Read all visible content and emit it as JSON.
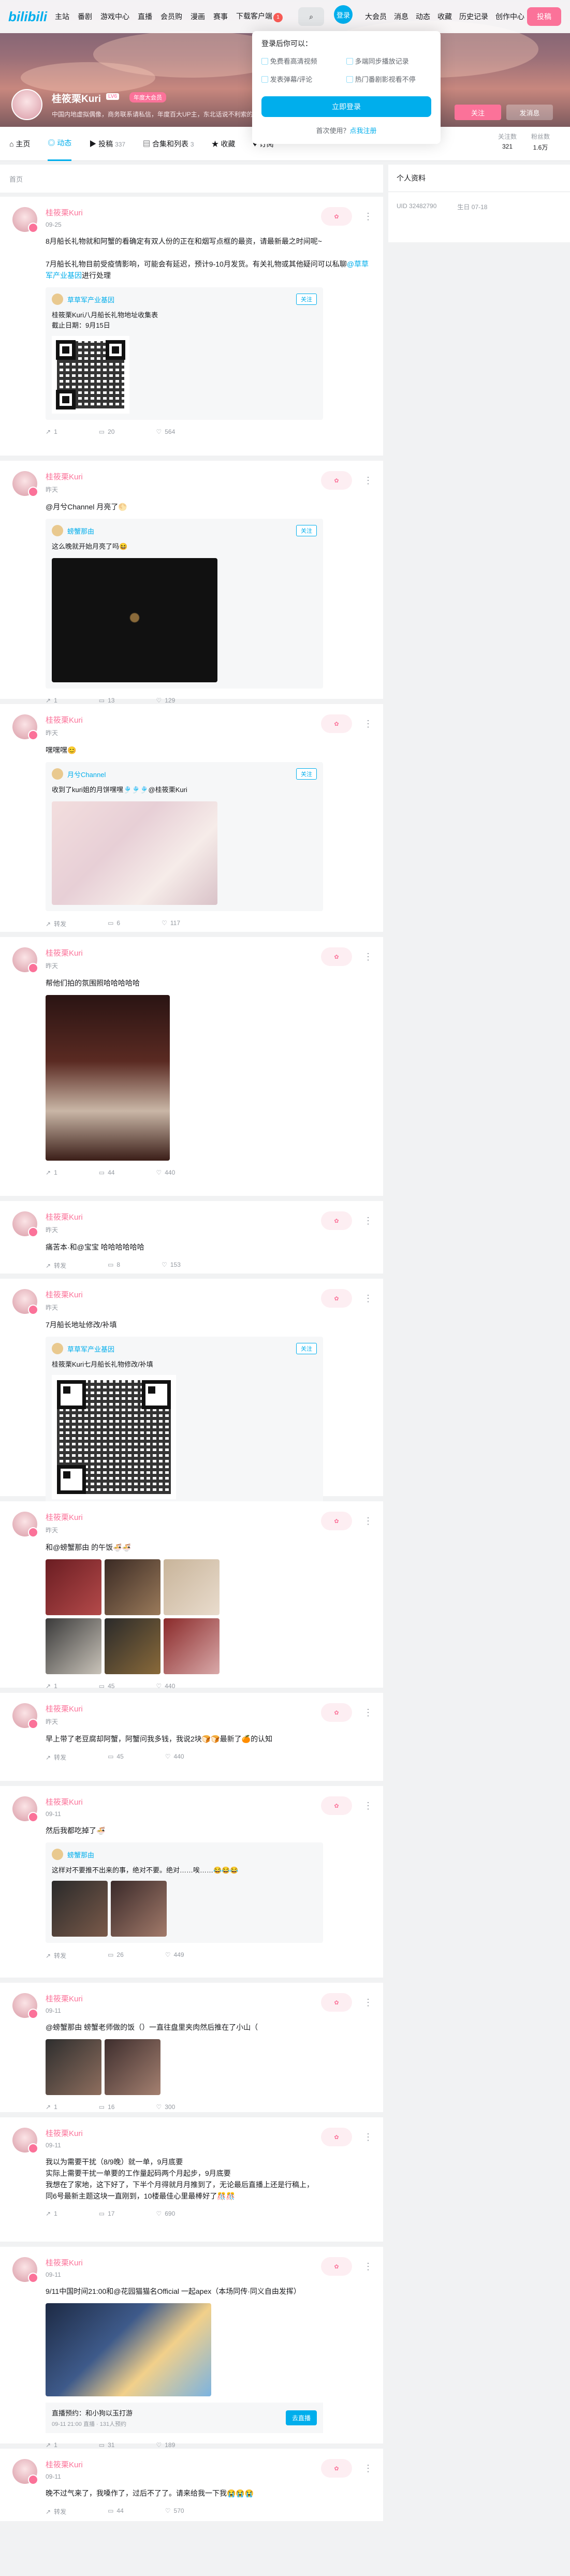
{
  "nav": {
    "logo": "bilibili",
    "items": [
      "主站",
      "番剧",
      "游戏中心",
      "直播",
      "会员购",
      "漫画",
      "赛事",
      "下载客户端"
    ],
    "download_badge": "1",
    "login": "登录",
    "right": [
      "大会员",
      "消息",
      "动态",
      "收藏",
      "历史记录",
      "创作中心"
    ],
    "contribute": "投稿"
  },
  "popup": {
    "title": "登录后你可以：",
    "features": [
      "免费看高清视频",
      "多端同步播放记录",
      "发表弹幕/评论",
      "热门番剧影视看不停"
    ],
    "login_btn": "立即登录",
    "register_prefix": "首次使用？",
    "register_link": "点我注册"
  },
  "profile": {
    "name": "桂筱栗Kuri",
    "level": "LV6",
    "vip": "年度大会员",
    "sign": "中国内地虚拟偶像，商务联系请私信，年度百大UP主，东北话说不利索的东北人",
    "follow": "关注",
    "message": "发消息"
  },
  "tabs": [
    {
      "label": "主页"
    },
    {
      "label": "动态"
    },
    {
      "label": "投稿",
      "count": "337"
    },
    {
      "label": "合集和列表",
      "count": "3"
    },
    {
      "label": "收藏"
    },
    {
      "label": "订阅"
    }
  ],
  "stats": [
    {
      "label": "关注数",
      "value": "321"
    },
    {
      "label": "粉丝数",
      "value": "1.6万"
    }
  ],
  "crumb": "首页",
  "side": {
    "title": "个人资料",
    "uid_label": "UID",
    "uid": "32482790",
    "birthday_label": "生日",
    "birthday": "07-18"
  },
  "posts": [
    {
      "name": "桂筱栗Kuri",
      "time": "09-25",
      "text": "8月船长礼物就和阿蟹的看确定有双人份的正在和烟写点框的最资，请最新最之时间呢~\n\n7月船长礼物目前受疫情影响，可能会有延迟，预计9-10月发货。有关礼物或其他疑问可以私聊",
      "link": "@草草军产业基因",
      "text2": "进行处理",
      "fwd": {
        "name": "草草军产业基因",
        "btn": "关注",
        "text": "桂筱栗Kuri八月船长礼物地址收集表\n截止日期：9月15日"
      },
      "acts": [
        "1",
        "20",
        "564"
      ]
    },
    {
      "name": "桂筱栗Kuri",
      "time": "昨天",
      "text": "@月兮Channel 月亮了🌕",
      "fwd": {
        "name": "螃蟹那由",
        "btn": "关注",
        "text": "这么晚就开始月亮了吗😆"
      },
      "acts": [
        "1",
        "13",
        "129"
      ]
    },
    {
      "name": "桂筱栗Kuri",
      "time": "昨天",
      "text": "嘿嘿嘿😊",
      "fwd": {
        "name": "月兮Channel",
        "btn": "关注",
        "text": "收到了kuri姐的月饼嘿嘿🎐🎐🎐@桂筱栗Kuri"
      },
      "acts": [
        "转发",
        "6",
        "117"
      ]
    },
    {
      "name": "桂筱栗Kuri",
      "time": "昨天",
      "text": "帮他们拍的氛围照哈哈哈哈哈",
      "acts": [
        "1",
        "44",
        "440"
      ]
    },
    {
      "name": "桂筱栗Kuri",
      "time": "昨天",
      "text": "痛苦本·和@宝宝 哈哈哈哈哈哈",
      "acts": [
        "转发",
        "8",
        "153"
      ]
    },
    {
      "name": "桂筱栗Kuri",
      "time": "昨天",
      "text": "7月船长地址修改/补填",
      "fwd": {
        "name": "草草军产业基因",
        "btn": "关注",
        "text": "桂筱栗Kuri七月船长礼物修改/补填"
      },
      "acts": [
        "1",
        "评论",
        "153"
      ]
    },
    {
      "name": "桂筱栗Kuri",
      "time": "昨天",
      "text": "和@螃蟹那由 的午饭🍜🍜",
      "acts": [
        "1",
        "45",
        "440"
      ]
    },
    {
      "name": "桂筱栗Kuri",
      "time": "昨天",
      "text": "早上带了老豆腐却阿蟹，阿蟹问我多钱，我说2块🍞🍞最新了🍊的认知",
      "acts": [
        "转发",
        "45",
        "440"
      ]
    },
    {
      "name": "桂筱栗Kuri",
      "time": "09-11",
      "text": "然后我都吃掉了🍜",
      "fwd": {
        "name": "螃蟹那由",
        "btn": "",
        "text": "这样对不要推不出来的事，绝对不要。绝对……唉……😂😂😂"
      },
      "acts": [
        "转发",
        "26",
        "449"
      ]
    },
    {
      "name": "桂筱栗Kuri",
      "time": "09-11",
      "text": "@螃蟹那由 螃蟹老师做的饭（）一直往盘里夹肉然后推在了小山（",
      "acts": [
        "1",
        "16",
        "300"
      ]
    },
    {
      "name": "桂筱栗Kuri",
      "time": "09-11",
      "text": "我以为需要干扰（8/9晚）就一单，9月底要\n实际上需要干扰一单要的工作量起码两个月起步，9月底要\n我想在了家地，这下好了，下半个月得就月月推到了，无论最后直播上还是行稿上，\n同6号最新主题这块一直刚到，10楼最佳心里最棒好了🎊🎊",
      "acts": [
        "1",
        "17",
        "690"
      ]
    },
    {
      "name": "桂筱栗Kuri",
      "time": "09-11",
      "text": "9/11中国时间21:00和@花园猫猫名Official 一起apex（本场同传·同义自由发挥）",
      "live": {
        "title": "直播预约：和小狗以玉打游",
        "sub": "09-11 21:00 直播 · 131人预约",
        "btn": "去直播"
      },
      "acts": [
        "1",
        "31",
        "189"
      ]
    },
    {
      "name": "桂筱栗Kuri",
      "time": "09-11",
      "text": "晚不过气来了，我嗓作了，过后不了了。请来给我一下我😭😭😭",
      "acts": [
        "转发",
        "44",
        "570"
      ]
    }
  ]
}
